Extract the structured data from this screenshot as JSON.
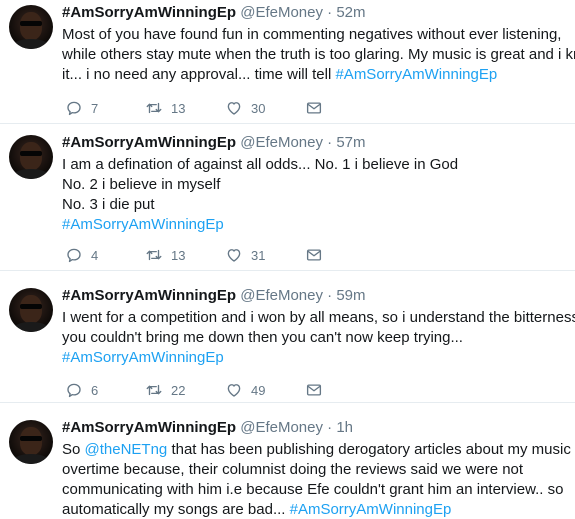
{
  "tweets": [
    {
      "name": "#AmSorryAmWinningEp",
      "handle": "@EfeMoney",
      "dot": "·",
      "time": "52m",
      "lines": [
        {
          "text": "Most of you have found fun in commenting negatives without ever listening,"
        },
        {
          "text": "while others stay mute when the truth is too glaring. My music is great and i know"
        },
        {
          "text": "it... i no need any approval... time will tell ",
          "link": "#AmSorryAmWinningEp"
        }
      ],
      "replies": "7",
      "retweets": "13",
      "likes": "30"
    },
    {
      "name": "#AmSorryAmWinningEp",
      "handle": "@EfeMoney",
      "dot": "·",
      "time": "57m",
      "lines": [
        {
          "text": "I am a defination of against all odds... No. 1 i believe in God"
        },
        {
          "text": "No. 2 i believe in myself"
        },
        {
          "text": "No. 3 i die put"
        },
        {
          "text": "",
          "link": "#AmSorryAmWinningEp"
        }
      ],
      "replies": "4",
      "retweets": "13",
      "likes": "31"
    },
    {
      "name": "#AmSorryAmWinningEp",
      "handle": "@EfeMoney",
      "dot": "·",
      "time": "59m",
      "lines": [
        {
          "text": "I went for a competition and i won by all means, so i understand the bitterness... if"
        },
        {
          "text": "you couldn't bring me down then you can't now keep trying..."
        },
        {
          "text": "",
          "link": "#AmSorryAmWinningEp"
        }
      ],
      "replies": "6",
      "retweets": "22",
      "likes": "49"
    },
    {
      "name": "#AmSorryAmWinningEp",
      "handle": "@EfeMoney",
      "dot": "·",
      "time": "1h",
      "lines": [
        {
          "pre": "So ",
          "mention": "@theNETng",
          "text": " that has been publishing  derogatory articles about my music"
        },
        {
          "text": "overtime because, their columnist doing the reviews said we were not"
        },
        {
          "text": "communicating with him i.e because Efe couldn't grant him an interview.. so"
        },
        {
          "text": "automatically my songs are bad... ",
          "link": "#AmSorryAmWinningEp"
        }
      ]
    }
  ]
}
